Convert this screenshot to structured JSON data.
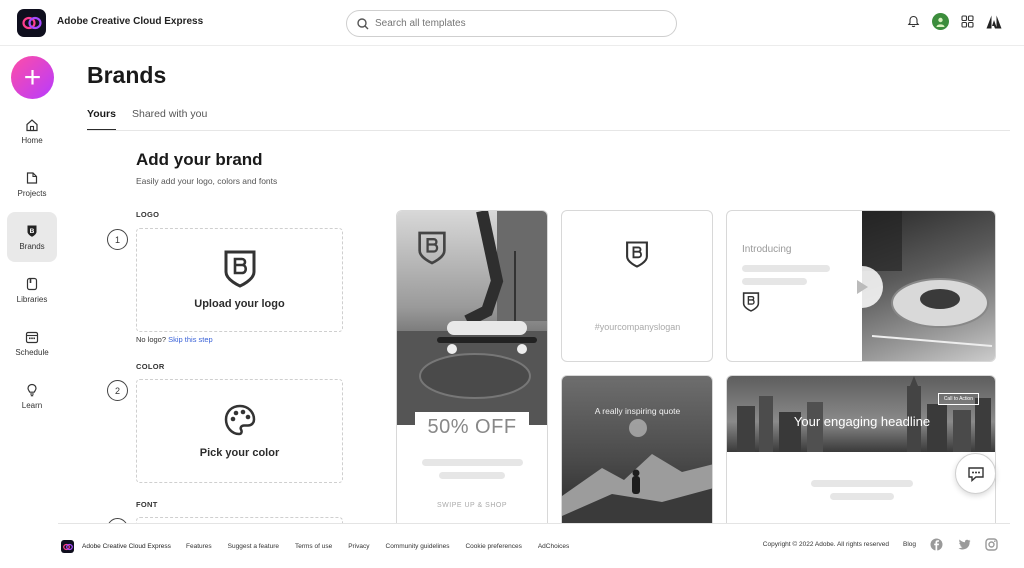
{
  "app": {
    "title": "Adobe Creative Cloud Express"
  },
  "search": {
    "placeholder": "Search all templates"
  },
  "header_icons": [
    "bell-icon",
    "avatar",
    "apps-grid-icon",
    "adobe-icon"
  ],
  "sidebar": {
    "create_label": "+",
    "items": [
      {
        "label": "Home",
        "icon": "home-icon"
      },
      {
        "label": "Projects",
        "icon": "projects-icon"
      },
      {
        "label": "Brands",
        "icon": "brands-icon",
        "active": true
      },
      {
        "label": "Libraries",
        "icon": "libraries-icon"
      },
      {
        "label": "Schedule",
        "icon": "calendar-icon"
      },
      {
        "label": "Learn",
        "icon": "lightbulb-icon"
      }
    ]
  },
  "page": {
    "title": "Brands",
    "tabs": [
      {
        "label": "Yours",
        "active": true
      },
      {
        "label": "Shared with you"
      }
    ]
  },
  "brand_setup": {
    "title": "Add your brand",
    "subtitle": "Easily add your logo, colors and fonts",
    "steps": [
      {
        "number": "1",
        "section": "LOGO",
        "action": "Upload your logo",
        "icon": "brand-shield-icon"
      },
      {
        "number": "2",
        "section": "COLOR",
        "action": "Pick your color",
        "icon": "palette-icon"
      }
    ],
    "no_logo_text": "No logo?",
    "skip_link": "Skip this step",
    "font_section": "FONT"
  },
  "previews": {
    "offer": "50% OFF",
    "swipe": "SWIPE UP & SHOP",
    "slogan": "#yourcompanyslogan",
    "introducing": "Introducing",
    "quote": "A really inspiring quote",
    "headline": "Your engaging headline",
    "cta": "Call to Action"
  },
  "footer": {
    "brand": "Adobe Creative Cloud Express",
    "links": [
      "Features",
      "Suggest a feature",
      "Terms of use",
      "Privacy",
      "Community guidelines",
      "Cookie preferences",
      "AdChoices"
    ],
    "copyright": "Copyright © 2022 Adobe. All rights reserved",
    "blog": "Blog",
    "social": [
      "facebook-icon",
      "twitter-icon",
      "instagram-icon"
    ]
  },
  "colors": {
    "create_gradient_start": "#ff4da6",
    "create_gradient_end": "#b73bff",
    "link": "#3b63d8",
    "active_nav_bg": "#e9e9e9"
  }
}
